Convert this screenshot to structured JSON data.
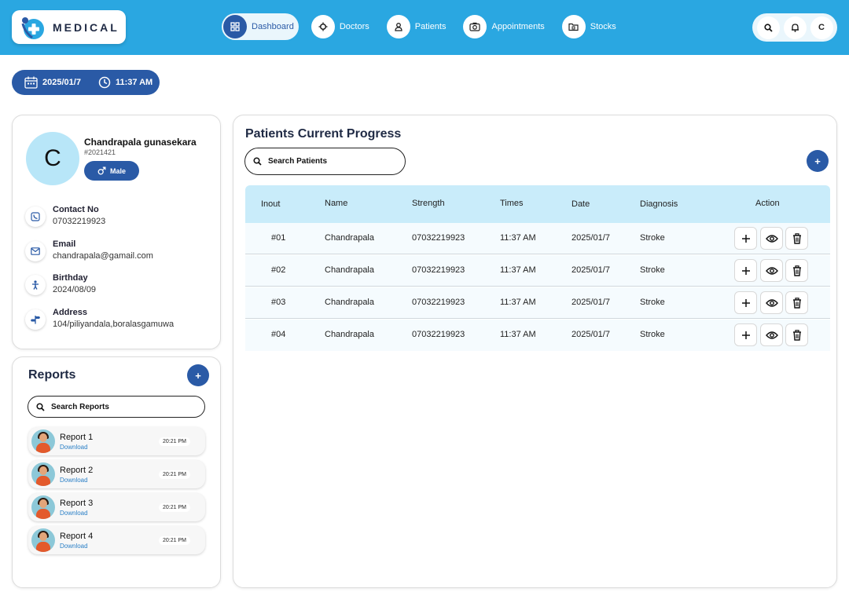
{
  "brand": {
    "name": "MEDICAL",
    "accent": "#2aa7e1",
    "primary": "#2a5aa6"
  },
  "nav": [
    {
      "label": "Dashboard",
      "icon": "dashboard-icon",
      "active": true
    },
    {
      "label": "Doctors",
      "icon": "doctor-icon",
      "active": false
    },
    {
      "label": "Patients",
      "icon": "patient-icon",
      "active": false
    },
    {
      "label": "Appointments",
      "icon": "camera-icon",
      "active": false
    },
    {
      "label": "Stocks",
      "icon": "folder-icon",
      "active": false
    }
  ],
  "tools": {
    "avatar_initial": "C"
  },
  "datetime": {
    "date": "2025/01/7",
    "time": "11:37 AM"
  },
  "profile": {
    "initial": "C",
    "name": "Chandrapala gunasekara",
    "id": "#2021421",
    "gender": "Male",
    "contact_label": "Contact No",
    "contact_value": "07032219923",
    "email_label": "Email",
    "email_value": "chandrapala@gamail.com",
    "birthday_label": "Birthday",
    "birthday_value": "2024/08/09",
    "address_label": "Address",
    "address_value": "104/piliyandala,boralasgamuwa"
  },
  "reports": {
    "title": "Reports",
    "add_label": "+",
    "search_placeholder": "Search Reports",
    "items": [
      {
        "title": "Report 1",
        "link": "Download",
        "time": "20:21 PM"
      },
      {
        "title": "Report 2",
        "link": "Download",
        "time": "20:21 PM"
      },
      {
        "title": "Report 3",
        "link": "Download",
        "time": "20:21 PM"
      },
      {
        "title": "Report 4",
        "link": "Download",
        "time": "20:21 PM"
      }
    ]
  },
  "progress": {
    "title": "Patients Current Progress",
    "add_label": "+",
    "search_placeholder": "Search Patients",
    "headers": [
      "Inout",
      "Name",
      "Strength",
      "Times",
      "Date",
      "Diagnosis",
      "Action"
    ],
    "rows": [
      {
        "inout": "#01",
        "name": "Chandrapala",
        "strength": "07032219923",
        "time": "11:37 AM",
        "date": "2025/01/7",
        "diagnosis": "Stroke"
      },
      {
        "inout": "#02",
        "name": "Chandrapala",
        "strength": "07032219923",
        "time": "11:37 AM",
        "date": "2025/01/7",
        "diagnosis": "Stroke"
      },
      {
        "inout": "#03",
        "name": "Chandrapala",
        "strength": "07032219923",
        "time": "11:37 AM",
        "date": "2025/01/7",
        "diagnosis": "Stroke"
      },
      {
        "inout": "#04",
        "name": "Chandrapala",
        "strength": "07032219923",
        "time": "11:37 AM",
        "date": "2025/01/7",
        "diagnosis": "Stroke"
      }
    ]
  }
}
